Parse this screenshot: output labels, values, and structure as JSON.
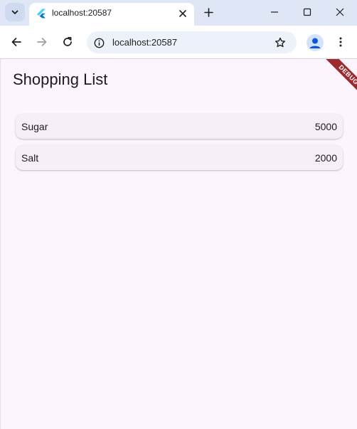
{
  "browser": {
    "tab": {
      "title": "localhost:20587"
    },
    "address": {
      "url": "localhost:20587"
    }
  },
  "app": {
    "title": "Shopping List",
    "debug_banner": "DEBUG",
    "items": [
      {
        "name": "Sugar",
        "quantity": "5000"
      },
      {
        "name": "Salt",
        "quantity": "2000"
      }
    ]
  },
  "colors": {
    "background": "#fcf5fd",
    "card": "#f6eff7",
    "debug_ribbon": "#9c2a2e",
    "tabstrip": "#dfe6f6"
  },
  "icons": {
    "tab_search": "chevron-down-icon",
    "favicon": "flutter-icon",
    "tab_close": "close-icon",
    "new_tab": "plus-icon",
    "minimize": "minimize-icon",
    "maximize": "maximize-icon",
    "close_window": "close-icon",
    "back": "back-arrow-icon",
    "forward": "forward-arrow-icon",
    "reload": "reload-icon",
    "site_info": "info-icon",
    "bookmark": "star-icon",
    "profile": "person-icon",
    "menu": "kebab-menu-icon"
  }
}
